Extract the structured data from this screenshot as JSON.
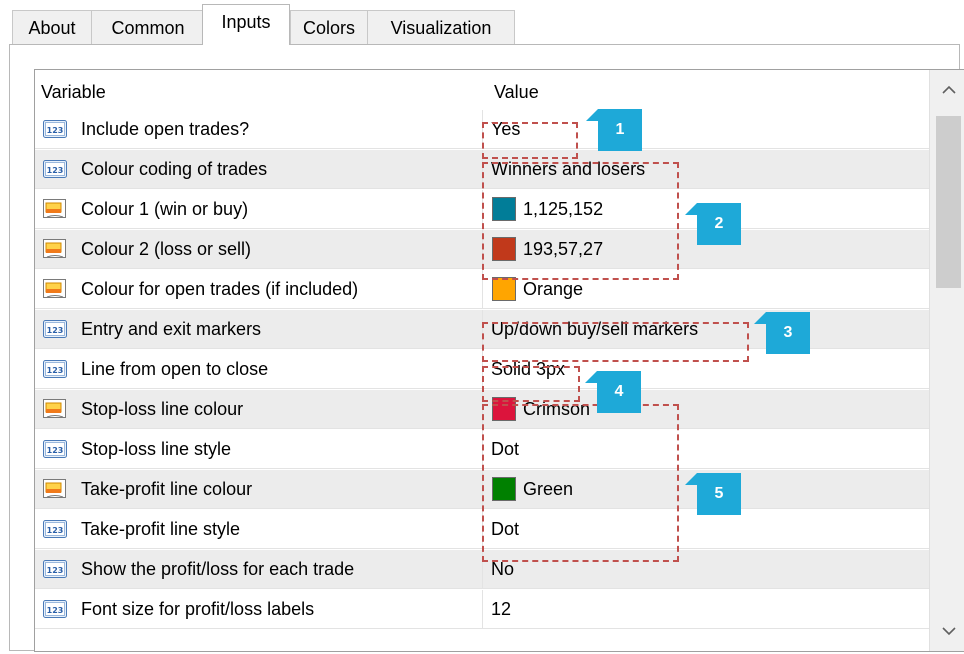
{
  "tabs": [
    "About",
    "Common",
    "Inputs",
    "Colors",
    "Visualization"
  ],
  "active_tab": "Inputs",
  "columns": {
    "variable": "Variable",
    "value": "Value"
  },
  "rows": [
    {
      "type": "number",
      "label": "Include open trades?",
      "value": "Yes"
    },
    {
      "type": "number",
      "label": "Colour coding of trades",
      "value": "Winners and losers"
    },
    {
      "type": "color",
      "label": "Colour 1 (win or buy)",
      "value": "1,125,152",
      "swatch": "#017d98"
    },
    {
      "type": "color",
      "label": "Colour 2 (loss or sell)",
      "value": "193,57,27",
      "swatch": "#c1391b"
    },
    {
      "type": "color",
      "label": "Colour for open trades (if included)",
      "value": "Orange",
      "swatch": "#ffa500"
    },
    {
      "type": "number",
      "label": "Entry and exit markers",
      "value": "Up/down buy/sell markers"
    },
    {
      "type": "number",
      "label": "Line from open to close",
      "value": "Solid 3px"
    },
    {
      "type": "color",
      "label": "Stop-loss line colour",
      "value": "Crimson",
      "swatch": "#dc143c"
    },
    {
      "type": "number",
      "label": "Stop-loss line style",
      "value": "Dot"
    },
    {
      "type": "color",
      "label": "Take-profit line colour",
      "value": "Green",
      "swatch": "#008000"
    },
    {
      "type": "number",
      "label": "Take-profit line style",
      "value": "Dot"
    },
    {
      "type": "number",
      "label": "Show the profit/loss for each trade",
      "value": "No"
    },
    {
      "type": "number",
      "label": "Font size for profit/loss labels",
      "value": "12"
    }
  ],
  "callouts": [
    "1",
    "2",
    "3",
    "4",
    "5"
  ],
  "icons": {
    "number": "number-param-icon",
    "color": "color-param-icon"
  },
  "colors": {
    "highlight": "#c0504d",
    "badge": "#1ea9d8",
    "alt_row": "#ececec"
  }
}
